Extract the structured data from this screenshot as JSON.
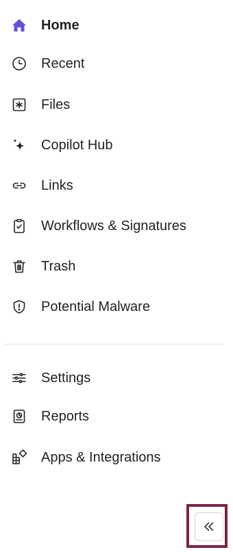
{
  "nav": {
    "primary": [
      {
        "label": "Home",
        "icon": "home-icon",
        "active": true
      },
      {
        "label": "Recent",
        "icon": "clock-icon"
      },
      {
        "label": "Files",
        "icon": "files-icon"
      },
      {
        "label": "Copilot Hub",
        "icon": "sparkle-icon"
      },
      {
        "label": "Links",
        "icon": "link-icon"
      },
      {
        "label": "Workflows & Signatures",
        "icon": "clipboard-check-icon"
      },
      {
        "label": "Trash",
        "icon": "trash-icon"
      },
      {
        "label": "Potential Malware",
        "icon": "shield-alert-icon"
      }
    ],
    "secondary": [
      {
        "label": "Settings",
        "icon": "sliders-icon"
      },
      {
        "label": "Reports",
        "icon": "report-icon"
      },
      {
        "label": "Apps & Integrations",
        "icon": "apps-icon"
      }
    ]
  },
  "collapse": {
    "icon": "double-chevron-left-icon"
  },
  "colors": {
    "active_icon": "#6b4fd8",
    "highlight_border": "#7a2346"
  }
}
